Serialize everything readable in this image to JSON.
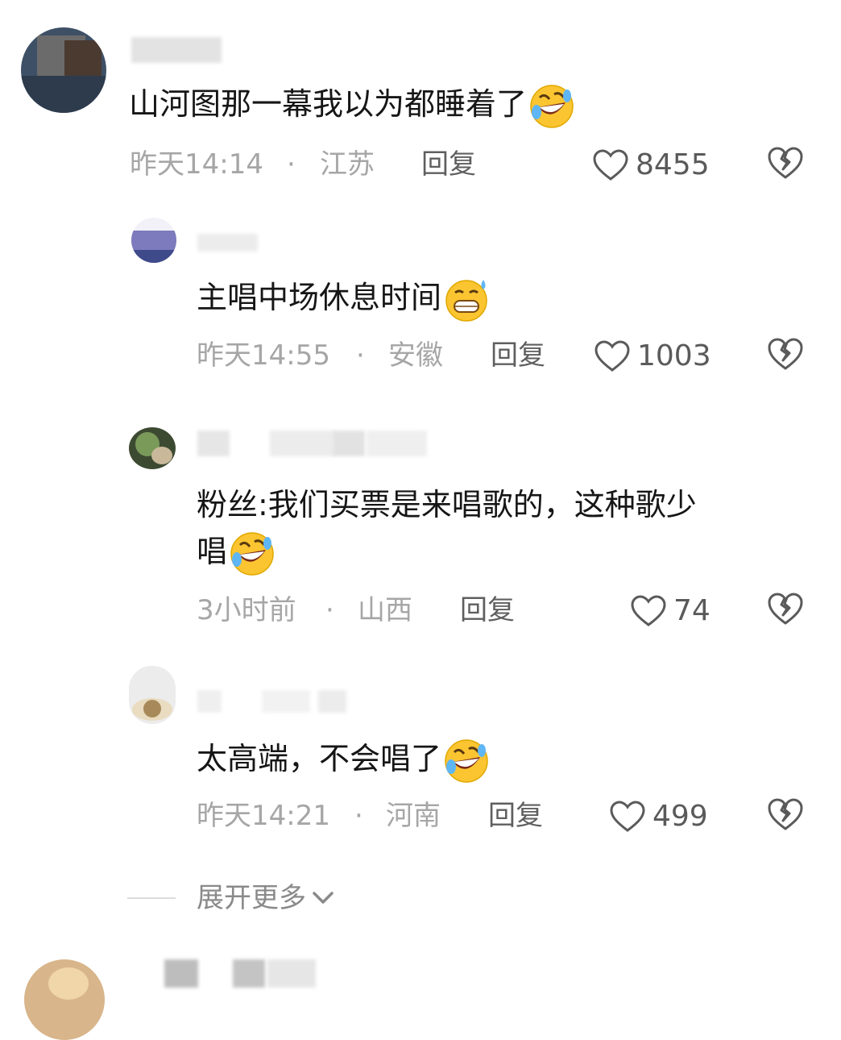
{
  "comments": [
    {
      "text": "山河图那一幕我以为都睡着了",
      "time": "昨天14:14",
      "location": "江苏",
      "reply_label": "回复",
      "likes": "8455",
      "emoji": "rofl-emoji"
    },
    {
      "text": "主唱中场休息时间",
      "time": "昨天14:55",
      "location": "安徽",
      "reply_label": "回复",
      "likes": "1003",
      "emoji": "grimace-sweat-emoji"
    },
    {
      "text_line1": "粉丝:我们买票是来唱歌的，这种歌少",
      "text_line2": "唱",
      "time": "3小时前",
      "location": "山西",
      "reply_label": "回复",
      "likes": "74",
      "emoji": "rofl-emoji"
    },
    {
      "text": "太高端，不会唱了",
      "time": "昨天14:21",
      "location": "河南",
      "reply_label": "回复",
      "likes": "499",
      "emoji": "rofl-emoji"
    }
  ],
  "separator": "·",
  "expand_more": "展开更多",
  "colors": {
    "text": "#161616",
    "meta": "#a6a6a6",
    "reply": "#5f5f5f",
    "icon": "#5a5a5a"
  }
}
